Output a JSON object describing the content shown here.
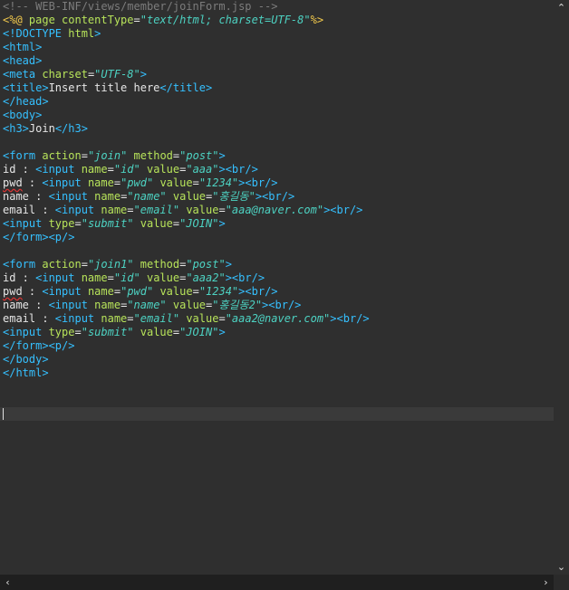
{
  "editor": {
    "caret_line": 31,
    "lines": [
      [
        {
          "c": "comment",
          "t": "<!-- WEB-INF/views/member/joinForm.jsp -->"
        }
      ],
      [
        {
          "c": "directive",
          "t": "<%@ "
        },
        {
          "c": "attr",
          "t": "page "
        },
        {
          "c": "attr",
          "t": "contentType"
        },
        {
          "c": "text",
          "t": "="
        },
        {
          "c": "val",
          "t": "\"text/html; charset=UTF-8\""
        },
        {
          "c": "directive",
          "t": "%>"
        }
      ],
      [
        {
          "c": "tag",
          "t": "<!DOCTYPE "
        },
        {
          "c": "attr",
          "t": "html"
        },
        {
          "c": "tag",
          "t": ">"
        }
      ],
      [
        {
          "c": "tag",
          "t": "<html>"
        }
      ],
      [
        {
          "c": "tag",
          "t": "<head>"
        }
      ],
      [
        {
          "c": "tag",
          "t": "<meta "
        },
        {
          "c": "attr",
          "t": "charset"
        },
        {
          "c": "text",
          "t": "="
        },
        {
          "c": "val",
          "t": "\"UTF-8\""
        },
        {
          "c": "tag",
          "t": ">"
        }
      ],
      [
        {
          "c": "tag",
          "t": "<title>"
        },
        {
          "c": "text",
          "t": "Insert title here"
        },
        {
          "c": "tag",
          "t": "</title>"
        }
      ],
      [
        {
          "c": "tag",
          "t": "</head>"
        }
      ],
      [
        {
          "c": "tag",
          "t": "<body>"
        }
      ],
      [
        {
          "c": "tag",
          "t": "<h3>"
        },
        {
          "c": "text",
          "t": "Join"
        },
        {
          "c": "tag",
          "t": "</h3>"
        }
      ],
      [],
      [
        {
          "c": "tag",
          "t": "<form "
        },
        {
          "c": "attr",
          "t": "action"
        },
        {
          "c": "text",
          "t": "="
        },
        {
          "c": "val",
          "t": "\"join\""
        },
        {
          "c": "text",
          "t": " "
        },
        {
          "c": "attr",
          "t": "method"
        },
        {
          "c": "text",
          "t": "="
        },
        {
          "c": "val",
          "t": "\"post\""
        },
        {
          "c": "tag",
          "t": ">"
        }
      ],
      [
        {
          "c": "text",
          "t": "id : "
        },
        {
          "c": "tag",
          "t": "<input "
        },
        {
          "c": "attr",
          "t": "name"
        },
        {
          "c": "text",
          "t": "="
        },
        {
          "c": "val",
          "t": "\"id\""
        },
        {
          "c": "text",
          "t": " "
        },
        {
          "c": "attr",
          "t": "value"
        },
        {
          "c": "text",
          "t": "="
        },
        {
          "c": "val",
          "t": "\"aaa\""
        },
        {
          "c": "tag",
          "t": "><br/>"
        }
      ],
      [
        {
          "c": "squiggle",
          "t": "pwd"
        },
        {
          "c": "text",
          "t": " : "
        },
        {
          "c": "tag",
          "t": "<input "
        },
        {
          "c": "attr",
          "t": "name"
        },
        {
          "c": "text",
          "t": "="
        },
        {
          "c": "val",
          "t": "\"pwd\""
        },
        {
          "c": "text",
          "t": " "
        },
        {
          "c": "attr",
          "t": "value"
        },
        {
          "c": "text",
          "t": "="
        },
        {
          "c": "val",
          "t": "\"1234\""
        },
        {
          "c": "tag",
          "t": "><br/>"
        }
      ],
      [
        {
          "c": "text",
          "t": "name : "
        },
        {
          "c": "tag",
          "t": "<input "
        },
        {
          "c": "attr",
          "t": "name"
        },
        {
          "c": "text",
          "t": "="
        },
        {
          "c": "val",
          "t": "\"name\""
        },
        {
          "c": "text",
          "t": " "
        },
        {
          "c": "attr",
          "t": "value"
        },
        {
          "c": "text",
          "t": "="
        },
        {
          "c": "val",
          "t": "\"홍길동\""
        },
        {
          "c": "tag",
          "t": "><br/>"
        }
      ],
      [
        {
          "c": "text",
          "t": "email : "
        },
        {
          "c": "tag",
          "t": "<input "
        },
        {
          "c": "attr",
          "t": "name"
        },
        {
          "c": "text",
          "t": "="
        },
        {
          "c": "val",
          "t": "\"email\""
        },
        {
          "c": "text",
          "t": " "
        },
        {
          "c": "attr",
          "t": "value"
        },
        {
          "c": "text",
          "t": "="
        },
        {
          "c": "val",
          "t": "\"aaa@naver.com\""
        },
        {
          "c": "tag",
          "t": "><br/>"
        }
      ],
      [
        {
          "c": "tag",
          "t": "<input "
        },
        {
          "c": "attr",
          "t": "type"
        },
        {
          "c": "text",
          "t": "="
        },
        {
          "c": "val",
          "t": "\"submit\""
        },
        {
          "c": "text",
          "t": " "
        },
        {
          "c": "attr",
          "t": "value"
        },
        {
          "c": "text",
          "t": "="
        },
        {
          "c": "val",
          "t": "\"JOIN\""
        },
        {
          "c": "tag",
          "t": ">"
        }
      ],
      [
        {
          "c": "tag",
          "t": "</form><p/>"
        }
      ],
      [],
      [
        {
          "c": "tag",
          "t": "<form "
        },
        {
          "c": "attr",
          "t": "action"
        },
        {
          "c": "text",
          "t": "="
        },
        {
          "c": "val",
          "t": "\"join1\""
        },
        {
          "c": "text",
          "t": " "
        },
        {
          "c": "attr",
          "t": "method"
        },
        {
          "c": "text",
          "t": "="
        },
        {
          "c": "val",
          "t": "\"post\""
        },
        {
          "c": "tag",
          "t": ">"
        }
      ],
      [
        {
          "c": "text",
          "t": "id : "
        },
        {
          "c": "tag",
          "t": "<input "
        },
        {
          "c": "attr",
          "t": "name"
        },
        {
          "c": "text",
          "t": "="
        },
        {
          "c": "val",
          "t": "\"id\""
        },
        {
          "c": "text",
          "t": " "
        },
        {
          "c": "attr",
          "t": "value"
        },
        {
          "c": "text",
          "t": "="
        },
        {
          "c": "val",
          "t": "\"aaa2\""
        },
        {
          "c": "tag",
          "t": "><br/>"
        }
      ],
      [
        {
          "c": "squiggle",
          "t": "pwd"
        },
        {
          "c": "text",
          "t": " : "
        },
        {
          "c": "tag",
          "t": "<input "
        },
        {
          "c": "attr",
          "t": "name"
        },
        {
          "c": "text",
          "t": "="
        },
        {
          "c": "val",
          "t": "\"pwd\""
        },
        {
          "c": "text",
          "t": " "
        },
        {
          "c": "attr",
          "t": "value"
        },
        {
          "c": "text",
          "t": "="
        },
        {
          "c": "val",
          "t": "\"1234\""
        },
        {
          "c": "tag",
          "t": "><br/>"
        }
      ],
      [
        {
          "c": "text",
          "t": "name : "
        },
        {
          "c": "tag",
          "t": "<input "
        },
        {
          "c": "attr",
          "t": "name"
        },
        {
          "c": "text",
          "t": "="
        },
        {
          "c": "val",
          "t": "\"name\""
        },
        {
          "c": "text",
          "t": " "
        },
        {
          "c": "attr",
          "t": "value"
        },
        {
          "c": "text",
          "t": "="
        },
        {
          "c": "val",
          "t": "\"홍길동2\""
        },
        {
          "c": "tag",
          "t": "><br/>"
        }
      ],
      [
        {
          "c": "text",
          "t": "email : "
        },
        {
          "c": "tag",
          "t": "<input "
        },
        {
          "c": "attr",
          "t": "name"
        },
        {
          "c": "text",
          "t": "="
        },
        {
          "c": "val",
          "t": "\"email\""
        },
        {
          "c": "text",
          "t": " "
        },
        {
          "c": "attr",
          "t": "value"
        },
        {
          "c": "text",
          "t": "="
        },
        {
          "c": "val",
          "t": "\"aaa2@naver.com\""
        },
        {
          "c": "tag",
          "t": "><br/>"
        }
      ],
      [
        {
          "c": "tag",
          "t": "<input "
        },
        {
          "c": "attr",
          "t": "type"
        },
        {
          "c": "text",
          "t": "="
        },
        {
          "c": "val",
          "t": "\"submit\""
        },
        {
          "c": "text",
          "t": " "
        },
        {
          "c": "attr",
          "t": "value"
        },
        {
          "c": "text",
          "t": "="
        },
        {
          "c": "val",
          "t": "\"JOIN\""
        },
        {
          "c": "tag",
          "t": ">"
        }
      ],
      [
        {
          "c": "tag",
          "t": "</form><p/>"
        }
      ],
      [
        {
          "c": "tag",
          "t": "</body>"
        }
      ],
      [
        {
          "c": "tag",
          "t": "</html>"
        }
      ],
      [],
      [],
      []
    ]
  },
  "scrollbars": {
    "vertical_up_icon": "chevron-up-icon",
    "vertical_down_icon": "chevron-down-icon",
    "horizontal_left_icon": "chevron-left-icon",
    "horizontal_right_icon": "chevron-right-icon",
    "up_glyph": "⌃",
    "down_glyph": "⌄",
    "left_glyph": "‹",
    "right_glyph": "›"
  },
  "colors": {
    "background": "#2f2f2f",
    "comment": "#7c7c7c",
    "directive": "#f2c94c",
    "tag": "#35c0ff",
    "attribute": "#b7e35a",
    "value": "#4dd2c2",
    "text": "#e6e6e6"
  }
}
